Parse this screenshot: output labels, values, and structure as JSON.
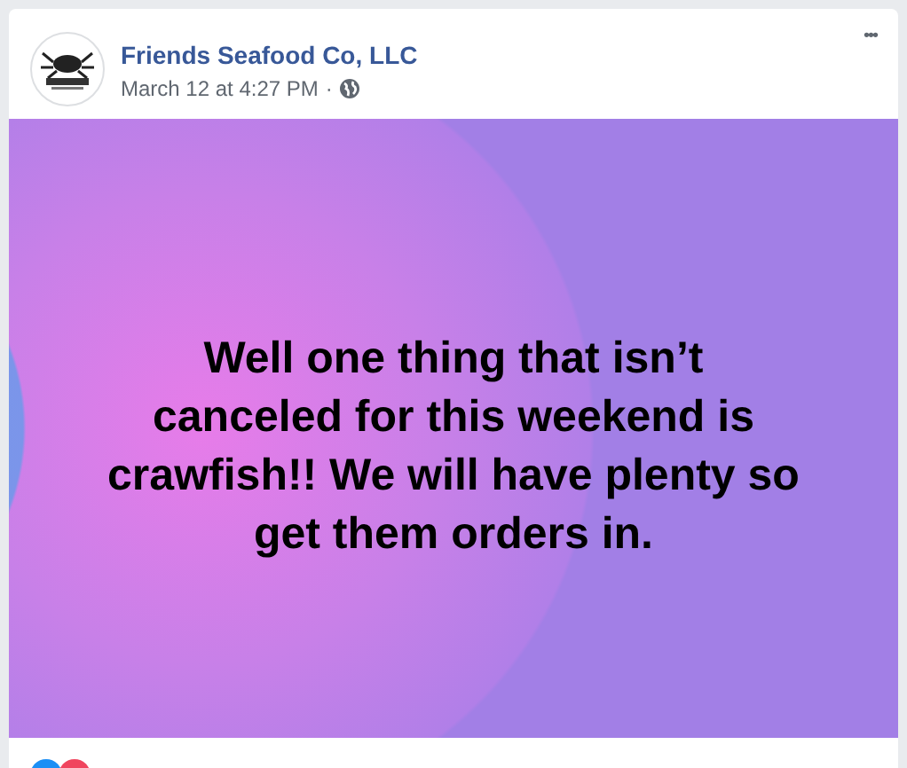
{
  "post": {
    "author": "Friends Seafood Co, LLC",
    "time": "March 12 at 4:27 PM",
    "separator": "·",
    "more": "•••",
    "text": "Well one thing that isn’t canceled for this weekend is crawfish!! We will have plenty so get them orders in."
  }
}
